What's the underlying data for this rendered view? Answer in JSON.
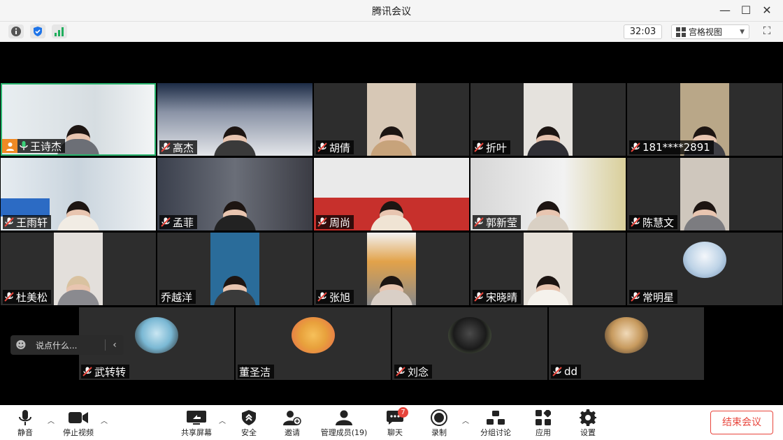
{
  "window": {
    "title": "腾讯会议"
  },
  "toolbar": {
    "timer": "32:03",
    "view_mode": "宫格视图"
  },
  "participants": [
    {
      "name": "王诗杰",
      "mic": "on",
      "host": true
    },
    {
      "name": "高杰",
      "mic": "off"
    },
    {
      "name": "胡倩",
      "mic": "off"
    },
    {
      "name": "折叶",
      "mic": "off"
    },
    {
      "name": "181****2891",
      "mic": "off"
    },
    {
      "name": "王雨轩",
      "mic": "off"
    },
    {
      "name": "孟菲",
      "mic": "off"
    },
    {
      "name": "周尚",
      "mic": "off"
    },
    {
      "name": "郭新莹",
      "mic": "off"
    },
    {
      "name": "陈慧文",
      "mic": "off"
    },
    {
      "name": "杜美松",
      "mic": "off"
    },
    {
      "name": "乔越洋",
      "mic": "none"
    },
    {
      "name": "张旭",
      "mic": "off"
    },
    {
      "name": "宋晓晴",
      "mic": "off"
    },
    {
      "name": "常明星",
      "mic": "off"
    },
    {
      "name": "武转转",
      "mic": "off"
    },
    {
      "name": "董圣洁",
      "mic": "none"
    },
    {
      "name": "刘念",
      "mic": "off"
    },
    {
      "name": "dd",
      "mic": "off"
    }
  ],
  "chat": {
    "placeholder": "说点什么..."
  },
  "controls": {
    "mute": "静音",
    "stop_video": "停止视频",
    "share_screen": "共享屏幕",
    "security": "安全",
    "invite": "邀请",
    "manage_members": "管理成员(19)",
    "chat": "聊天",
    "chat_badge": "7",
    "record": "录制",
    "breakout": "分组讨论",
    "apps": "应用",
    "settings": "设置",
    "end_meeting": "结束会议"
  },
  "colors": {
    "accent_red": "#e8453c",
    "host_orange": "#f08a24",
    "active_border": "#2ab56f"
  }
}
